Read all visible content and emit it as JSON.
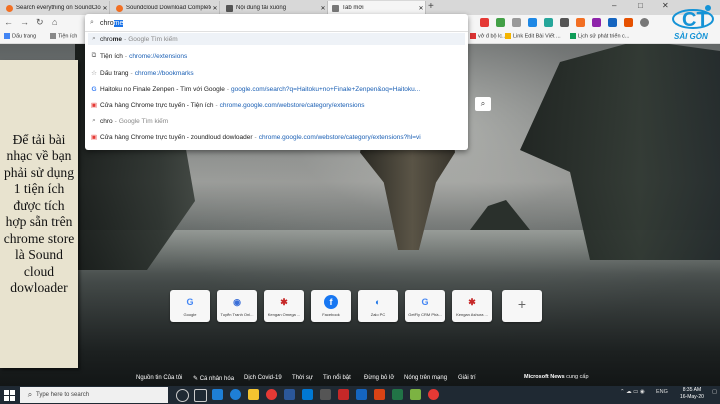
{
  "browser": {
    "tabs": [
      {
        "label": "Search everything on SoundClo...",
        "favicon_color": "#f26f23"
      },
      {
        "label": "Soundcloud Download Complete...",
        "favicon_color": "#f26f23"
      },
      {
        "label": "Nội dung tải xuống",
        "favicon_color": "#555555"
      },
      {
        "label": "Tab mới",
        "favicon_color": "#777777"
      }
    ],
    "new_tab_label": "+",
    "window_controls": {
      "minimize": "–",
      "maximize": "□",
      "close": "✕"
    },
    "omnibox": {
      "typed": "chro",
      "autocomplete": "me"
    },
    "bookmarks": [
      {
        "label": "Dấu trang"
      },
      {
        "label": "Tiện ích"
      },
      {
        "label": "vở đ bộ lc..."
      },
      {
        "label": "Link Edit Bài Viết ..."
      },
      {
        "label": "Lịch sử phát triển c..."
      }
    ],
    "suggestions": [
      {
        "icon": "search-icon",
        "title_bold": "chrome",
        "title_rest": "",
        "sep": " - ",
        "url": "",
        "note": "Google Tìm kiếm",
        "highlight": true
      },
      {
        "icon": "extension-icon",
        "title_bold": "",
        "title_rest": "Tiện ích",
        "sep": " - ",
        "url": "chrome://extensions",
        "note": "",
        "highlight": false
      },
      {
        "icon": "star-icon",
        "title_bold": "",
        "title_rest": "Dấu trang",
        "sep": " - ",
        "url": "chrome://bookmarks",
        "note": "",
        "highlight": false
      },
      {
        "icon": "google-icon",
        "title_bold": "",
        "title_rest": "Haitoku no Finale Zenpen - Tìm với Google",
        "sep": " - ",
        "url": "google.com/search?q=Haitoku+no+Finale+Zenpen&oq=Haitoku...",
        "note": "",
        "highlight": false
      },
      {
        "icon": "store-icon",
        "title_bold": "",
        "title_rest": "Cửa hàng Chrome trực tuyến - Tiện ích",
        "sep": " - ",
        "url": "chrome.google.com/webstore/category/extensions",
        "note": "",
        "highlight": false
      },
      {
        "icon": "search-icon",
        "title_bold": "",
        "title_rest": "chro",
        "sep": " - ",
        "url": "",
        "note": "Google Tìm kiếm",
        "highlight": false
      },
      {
        "icon": "store-icon",
        "title_bold": "",
        "title_rest": "Cửa hàng Chrome trực tuyến - zoundloud dowloader",
        "sep": " - ",
        "url": "chrome.google.com/webstore/category/extensions?hl=vi",
        "note": "",
        "highlight": false
      }
    ]
  },
  "logo": {
    "text": "SÀI GÒN"
  },
  "caption": {
    "text": "Để tải bài nhạc về bạn phải sử dụng 1 tiện ích được tích hợp sẵn trên chrome store là Sound cloud dowloader"
  },
  "tiles": [
    {
      "label": "Google",
      "glyph": "G",
      "color": "#4285f4"
    },
    {
      "label": "Tuyển Tranh Onl...",
      "glyph": "◉",
      "color": "#3b6fd8"
    },
    {
      "label": "Kengan Omega ...",
      "glyph": "✱",
      "color": "#c62828"
    },
    {
      "label": "Facebook",
      "glyph": "f",
      "color": "#1877f2"
    },
    {
      "label": "Zalo PC",
      "glyph": "◐",
      "color": "#1a73e8"
    },
    {
      "label": "GetFly CRM Phầ...",
      "glyph": "G",
      "color": "#4285f4"
    },
    {
      "label": "Kengan Ashura ...",
      "glyph": "✱",
      "color": "#c62828"
    }
  ],
  "add_tile": "+",
  "bottom_nav": [
    "Nguồn tin Của tôi",
    "Cá nhân hóa",
    "Dịch Covid-19",
    "Thời sự",
    "Tin nổi bật",
    "Đừng bỏ lỡ",
    "Nóng trên mạng",
    "Giải trí"
  ],
  "msn": {
    "brand": "Microsoft News",
    "suffix": " cung cấp"
  },
  "taskbar": {
    "search_placeholder": "Type here to search",
    "lang": "ENG",
    "time": "8:35 AM",
    "date": "16-May-20"
  }
}
